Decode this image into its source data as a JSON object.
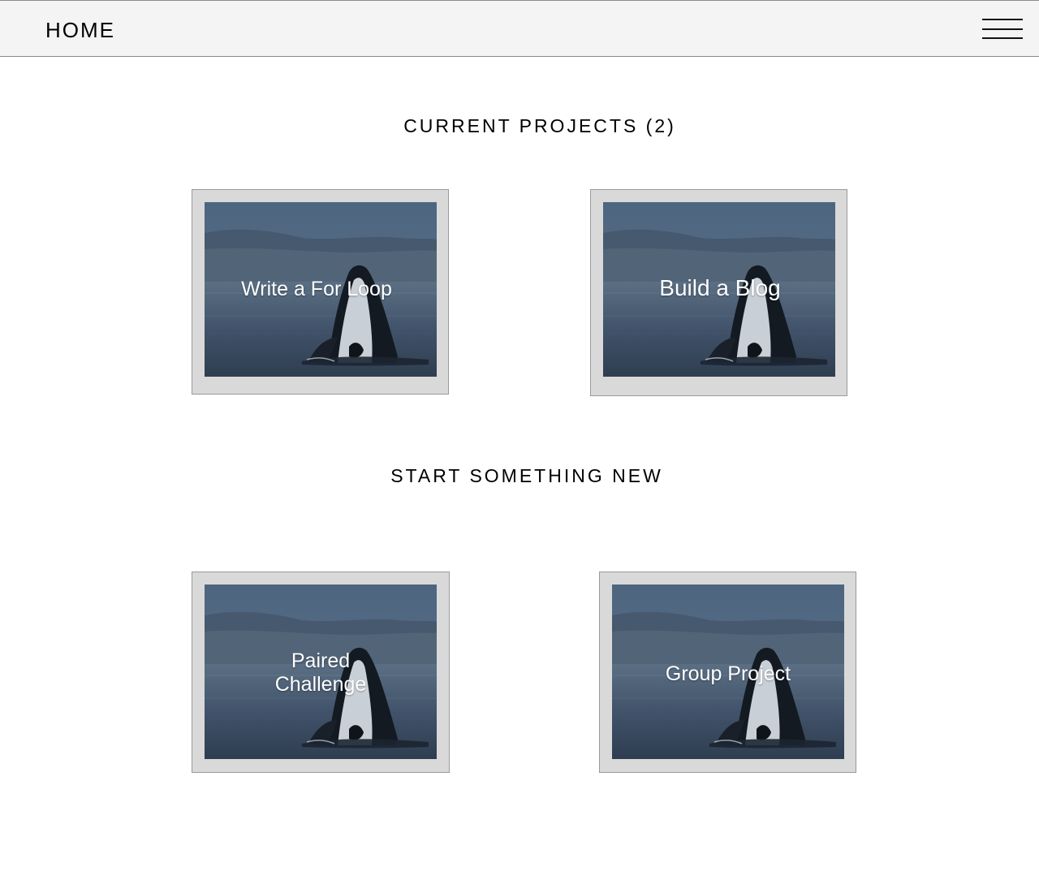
{
  "nav": {
    "home_label": "HOME",
    "menu_icon": "hamburger-menu-icon"
  },
  "current_projects": {
    "title": "CURRENT PROJECTS (2)",
    "cards": [
      {
        "label": "Write a For Loop",
        "image": "orca-breaching-photo"
      },
      {
        "label": "Build a Blog",
        "image": "orca-breaching-photo"
      }
    ]
  },
  "start_new": {
    "title": "START SOMETHING NEW",
    "cards": [
      {
        "label": "Paired Challenge",
        "image": "orca-breaching-photo"
      },
      {
        "label": "Group Project",
        "image": "orca-breaching-photo"
      }
    ]
  },
  "colors": {
    "topbar_bg": "#f4f4f4",
    "card_frame": "#d9d9d9",
    "label_text": "#ffffff"
  }
}
